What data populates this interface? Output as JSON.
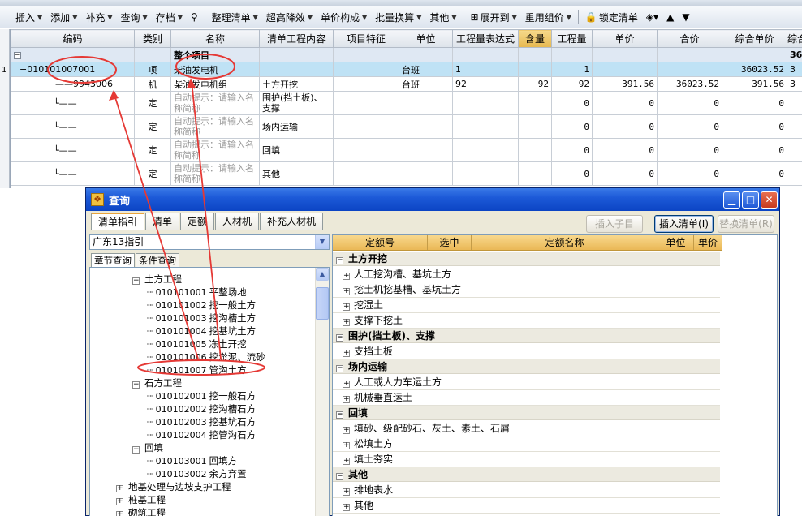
{
  "toolbar": {
    "items": [
      {
        "label": "插入",
        "caret": true
      },
      {
        "label": "添加",
        "caret": true
      },
      {
        "label": "补充",
        "caret": true
      },
      {
        "label": "查询",
        "caret": true
      },
      {
        "label": "存档",
        "caret": true
      },
      {
        "label": "整理清单",
        "caret": true
      },
      {
        "label": "超高降效",
        "caret": true
      },
      {
        "label": "单价构成",
        "caret": true
      },
      {
        "label": "批量换算",
        "caret": true
      },
      {
        "label": "其他",
        "caret": true
      },
      {
        "label": "展开到",
        "caret": true
      },
      {
        "label": "重用组价",
        "caret": true
      },
      {
        "label": "锁定清单",
        "caret": false
      }
    ]
  },
  "grid": {
    "columns": [
      "编码",
      "类别",
      "名称",
      "清单工程内容",
      "项目特征",
      "单位",
      "工程量表达式",
      "含量",
      "工程量",
      "单价",
      "合价",
      "综合单价",
      "综合"
    ],
    "group_row": {
      "expander": "−",
      "name": "整个项目",
      "tail": "36"
    },
    "row_number": "1",
    "rows": [
      {
        "code": "010101007001",
        "expander": "−",
        "category": "项",
        "name": "柴油发电机",
        "content": "",
        "feature": "",
        "unit": "台班",
        "expr": "1",
        "content_qty": "",
        "qty": "1",
        "price": "",
        "total": "",
        "comp_price": "36023.52",
        "tail": "3"
      },
      {
        "code": "9943006",
        "category": "机",
        "name": "柴油发电机组",
        "content": "土方开挖",
        "feature": "",
        "unit": "台班",
        "expr": "92",
        "content_qty": "92",
        "qty": "92",
        "price": "391.56",
        "total": "36023.52",
        "comp_price": "391.56",
        "tail": "3"
      },
      {
        "code": "",
        "category": "定",
        "name": "自动提示：请输入名称简称",
        "content": "围护(挡土板)、支撑",
        "qty": "0",
        "price": "0",
        "total": "0",
        "comp_price": "0"
      },
      {
        "code": "",
        "category": "定",
        "name": "自动提示：请输入名称简称",
        "content": "场内运输",
        "qty": "0",
        "price": "0",
        "total": "0",
        "comp_price": "0"
      },
      {
        "code": "",
        "category": "定",
        "name": "自动提示：请输入名称简称",
        "content": "回填",
        "qty": "0",
        "price": "0",
        "total": "0",
        "comp_price": "0"
      },
      {
        "code": "",
        "category": "定",
        "name": "自动提示：请输入名称简称",
        "content": "其他",
        "qty": "0",
        "price": "0",
        "total": "0",
        "comp_price": "0"
      }
    ]
  },
  "dialog": {
    "title": "查询",
    "tabs": [
      "清单指引",
      "清单",
      "定额",
      "人材机",
      "补充人材机"
    ],
    "buttons": {
      "insert_child": "插入子目",
      "insert_list": "插入清单(I)",
      "replace_list": "替换清单(R)"
    },
    "combo_value": "广东13指引",
    "left_tabs": [
      "章节查询",
      "条件查询"
    ],
    "tree": [
      {
        "type": "group",
        "label": "土方工程",
        "expanded": true
      },
      {
        "type": "leaf",
        "code": "010101001",
        "label": "平整场地"
      },
      {
        "type": "leaf",
        "code": "010101002",
        "label": "挖一般土方"
      },
      {
        "type": "leaf",
        "code": "010101003",
        "label": "挖沟槽土方"
      },
      {
        "type": "leaf",
        "code": "010101004",
        "label": "挖基坑土方"
      },
      {
        "type": "leaf",
        "code": "010101005",
        "label": "冻土开挖"
      },
      {
        "type": "leaf",
        "code": "010101006",
        "label": "挖淤泥、流砂"
      },
      {
        "type": "leaf",
        "code": "010101007",
        "label": "管沟土方"
      },
      {
        "type": "group",
        "label": "石方工程",
        "expanded": true
      },
      {
        "type": "leaf",
        "code": "010102001",
        "label": "挖一般石方"
      },
      {
        "type": "leaf",
        "code": "010102002",
        "label": "挖沟槽石方"
      },
      {
        "type": "leaf",
        "code": "010102003",
        "label": "挖基坑石方"
      },
      {
        "type": "leaf",
        "code": "010102004",
        "label": "挖管沟石方"
      },
      {
        "type": "group",
        "label": "回填",
        "expanded": true
      },
      {
        "type": "leaf",
        "code": "010103001",
        "label": "回填方"
      },
      {
        "type": "leaf",
        "code": "010103002",
        "label": "余方弃置"
      },
      {
        "type": "top",
        "label": "地基处理与边坡支护工程"
      },
      {
        "type": "top",
        "label": "桩基工程"
      },
      {
        "type": "top",
        "label": "砌筑工程"
      }
    ],
    "right_columns": [
      "定额号",
      "选中",
      "定额名称",
      "单位",
      "单价"
    ],
    "right_rows": [
      {
        "type": "group",
        "label": "土方开挖"
      },
      {
        "type": "item",
        "label": "人工挖沟槽、基坑土方"
      },
      {
        "type": "item",
        "label": "挖土机挖基槽、基坑土方"
      },
      {
        "type": "item",
        "label": "挖湿土"
      },
      {
        "type": "item",
        "label": "支撑下挖土"
      },
      {
        "type": "group",
        "label": "围护(挡土板)、支撑"
      },
      {
        "type": "item",
        "label": "支挡土板"
      },
      {
        "type": "group",
        "label": "场内运输"
      },
      {
        "type": "item",
        "label": "人工或人力车运土方"
      },
      {
        "type": "item",
        "label": "机械垂直运土"
      },
      {
        "type": "group",
        "label": "回填"
      },
      {
        "type": "item",
        "label": "填砂、级配砂石、灰土、素土、石屑"
      },
      {
        "type": "item",
        "label": "松填土方"
      },
      {
        "type": "item",
        "label": "填土夯实"
      },
      {
        "type": "group",
        "label": "其他"
      },
      {
        "type": "item",
        "label": "排地表水"
      },
      {
        "type": "item",
        "label": "其他"
      }
    ]
  },
  "colors": {
    "annotation": "#e53935",
    "title_bar": "#0b44c4",
    "column_highlight": "#e6b84f",
    "selected_row": "#bfe2f5"
  }
}
